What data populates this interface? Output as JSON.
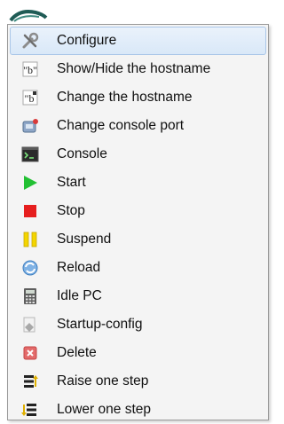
{
  "menu": {
    "items": [
      {
        "label": "Configure",
        "icon": "wrench-screwdriver-icon"
      },
      {
        "label": "Show/Hide the hostname",
        "icon": "hostname-tag-icon"
      },
      {
        "label": "Change the hostname",
        "icon": "hostname-edit-icon"
      },
      {
        "label": "Change console port",
        "icon": "console-port-icon"
      },
      {
        "label": "Console",
        "icon": "terminal-icon"
      },
      {
        "label": "Start",
        "icon": "play-icon"
      },
      {
        "label": "Stop",
        "icon": "stop-icon"
      },
      {
        "label": "Suspend",
        "icon": "pause-icon"
      },
      {
        "label": "Reload",
        "icon": "reload-icon"
      },
      {
        "label": "Idle PC",
        "icon": "calculator-icon"
      },
      {
        "label": "Startup-config",
        "icon": "config-file-icon"
      },
      {
        "label": "Delete",
        "icon": "delete-icon"
      },
      {
        "label": "Raise one step",
        "icon": "raise-layer-icon"
      },
      {
        "label": "Lower one step",
        "icon": "lower-layer-icon"
      }
    ],
    "highlighted_index": 0
  },
  "colors": {
    "highlight_border": "#a9c6e8",
    "highlight_fill": "#dde9f8",
    "start_green": "#22c033",
    "stop_red": "#e61e1e",
    "suspend_yellow": "#f3d500"
  }
}
